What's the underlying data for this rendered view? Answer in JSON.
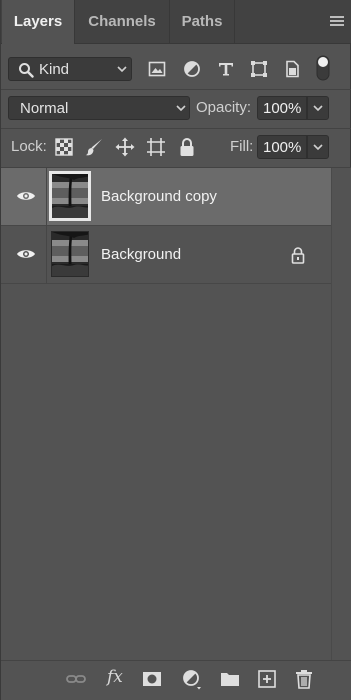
{
  "tabs": [
    {
      "label": "Layers",
      "active": true
    },
    {
      "label": "Channels",
      "active": false
    },
    {
      "label": "Paths",
      "active": false
    }
  ],
  "filter": {
    "kind_label": "Kind",
    "icons": [
      "image-filter-icon",
      "adjustment-filter-icon",
      "type-filter-icon",
      "shape-filter-icon",
      "smart-object-filter-icon",
      "filter-toggle-icon"
    ]
  },
  "blend": {
    "mode": "Normal",
    "opacity_label": "Opacity:",
    "opacity_value": "100%",
    "fill_label": "Fill:",
    "fill_value": "100%"
  },
  "lock": {
    "label": "Lock:",
    "icons": [
      "lock-transparent-pixels-icon",
      "lock-image-pixels-icon",
      "lock-position-icon",
      "lock-artboard-icon",
      "lock-all-icon"
    ]
  },
  "layers": [
    {
      "name": "Background copy",
      "visible": true,
      "selected": true,
      "locked": false
    },
    {
      "name": "Background",
      "visible": true,
      "selected": false,
      "locked": true
    }
  ],
  "bottom_bar": {
    "fx_label": "fx",
    "icons": [
      "link-layers-icon",
      "layer-style-icon",
      "add-mask-icon",
      "adjustment-layer-icon",
      "new-group-icon",
      "new-layer-icon",
      "delete-layer-icon"
    ]
  },
  "colors": {
    "panel_bg": "#535353",
    "tab_bar_bg": "#424242",
    "selected_row_bg": "#6b6b6b",
    "field_bg": "#3b3b3b"
  }
}
